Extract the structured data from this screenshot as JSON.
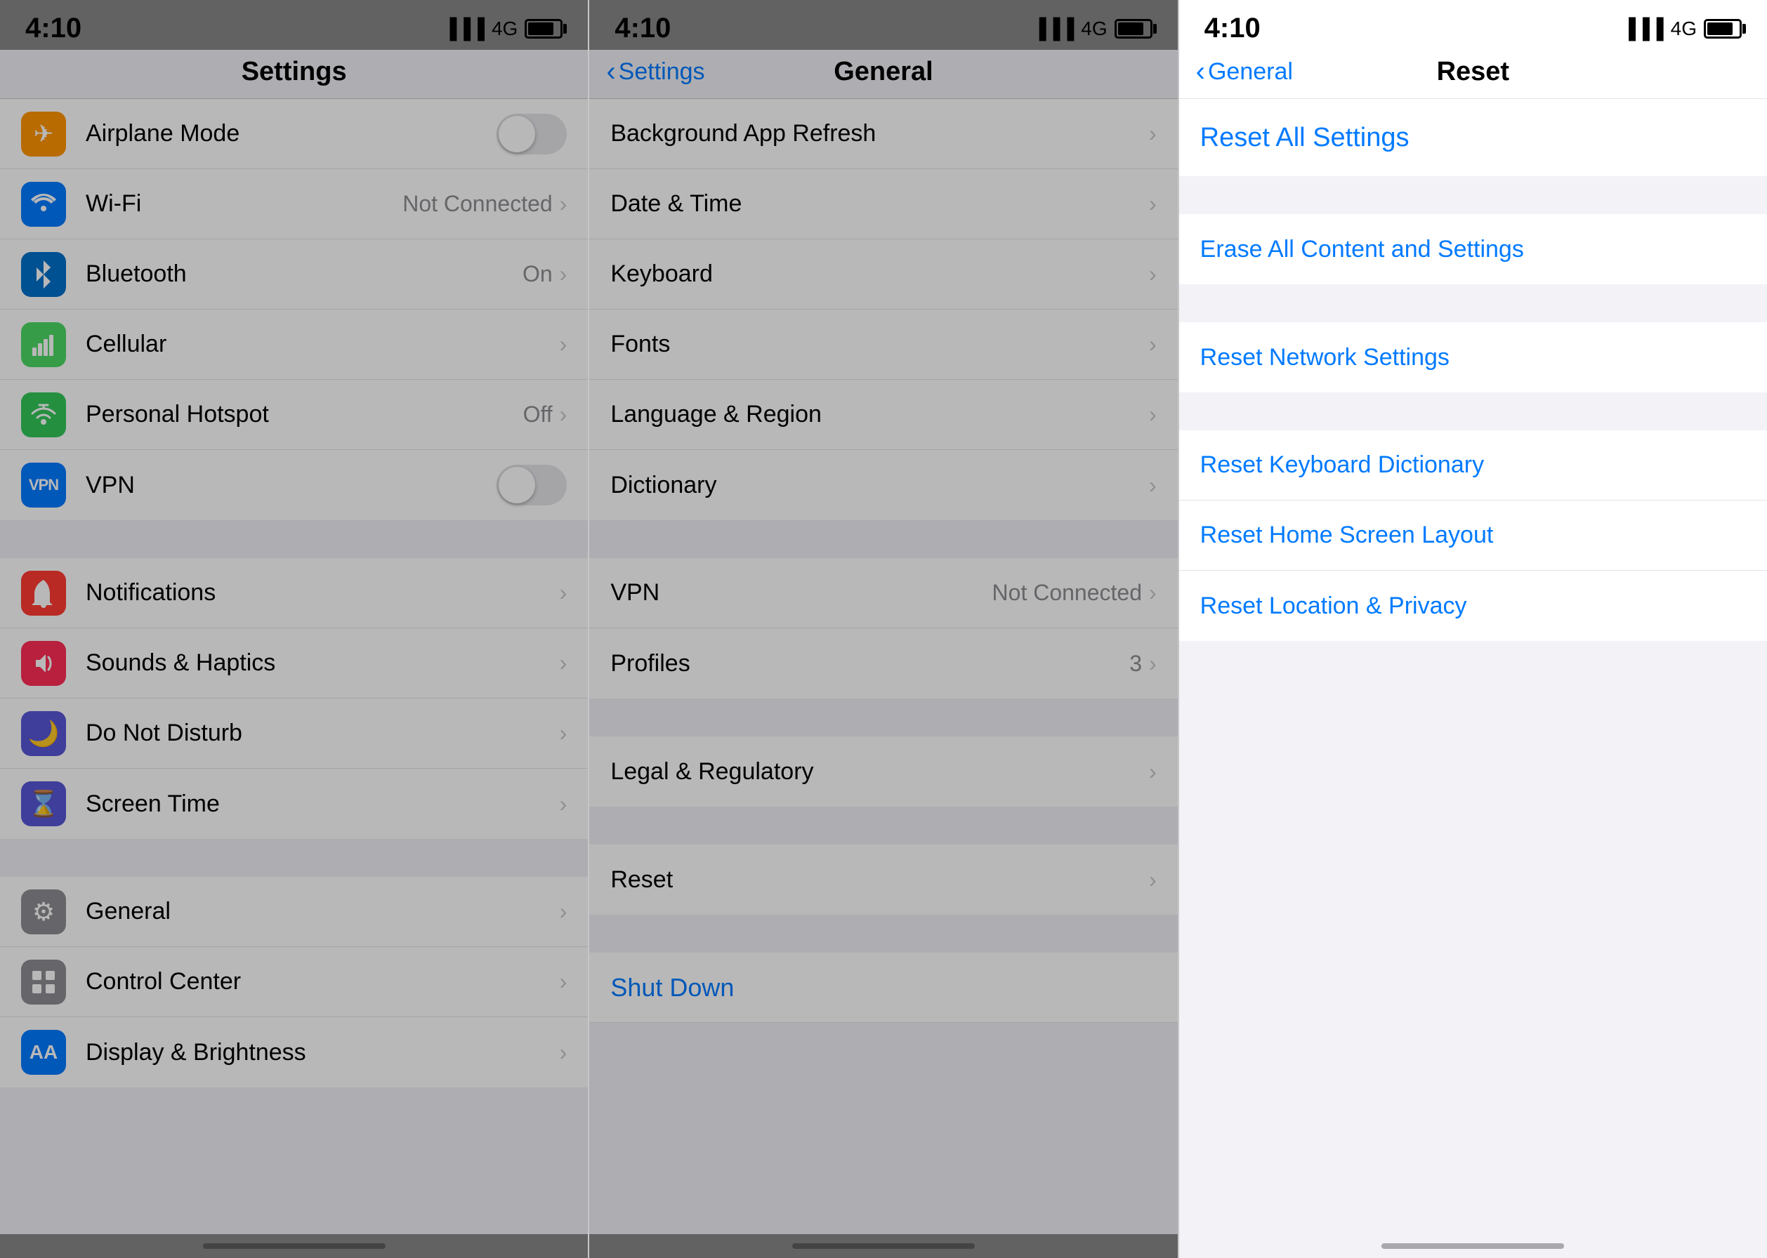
{
  "panel1": {
    "time": "4:10",
    "signal": "4G",
    "nav_title": "Settings",
    "items_group1": [
      {
        "id": "airplane",
        "label": "Airplane Mode",
        "icon_color": "orange",
        "icon_symbol": "✈",
        "type": "toggle",
        "toggle_on": false
      },
      {
        "id": "wifi",
        "label": "Wi-Fi",
        "icon_color": "blue",
        "icon_symbol": "📶",
        "type": "value",
        "value": "Not Connected"
      },
      {
        "id": "bluetooth",
        "label": "Bluetooth",
        "icon_color": "bluetooth",
        "icon_symbol": "🔷",
        "type": "value",
        "value": "On"
      },
      {
        "id": "cellular",
        "label": "Cellular",
        "icon_color": "green",
        "icon_symbol": "📡",
        "type": "chevron"
      },
      {
        "id": "hotspot",
        "label": "Personal Hotspot",
        "icon_color": "green2",
        "icon_symbol": "🔗",
        "type": "value",
        "value": "Off"
      },
      {
        "id": "vpn",
        "label": "VPN",
        "icon_color": "vpn",
        "icon_symbol": "VPN",
        "type": "toggle",
        "toggle_on": false
      }
    ],
    "items_group2": [
      {
        "id": "notifications",
        "label": "Notifications",
        "icon_color": "red",
        "icon_symbol": "🔔",
        "type": "chevron"
      },
      {
        "id": "sounds",
        "label": "Sounds & Haptics",
        "icon_color": "red2",
        "icon_symbol": "🔊",
        "type": "chevron"
      },
      {
        "id": "donotdisturb",
        "label": "Do Not Disturb",
        "icon_color": "indigo",
        "icon_symbol": "🌙",
        "type": "chevron"
      },
      {
        "id": "screentime",
        "label": "Screen Time",
        "icon_color": "screen-time",
        "icon_symbol": "⌛",
        "type": "chevron"
      }
    ],
    "items_group3": [
      {
        "id": "general",
        "label": "General",
        "icon_color": "general",
        "icon_symbol": "⚙",
        "type": "chevron",
        "highlighted": true
      },
      {
        "id": "controlcenter",
        "label": "Control Center",
        "icon_color": "control",
        "icon_symbol": "🎚",
        "type": "chevron"
      },
      {
        "id": "displaybrightness",
        "label": "Display & Brightness",
        "icon_color": "display",
        "icon_symbol": "AA",
        "type": "chevron"
      }
    ]
  },
  "panel2": {
    "time": "4:10",
    "signal": "4G",
    "nav_title": "General",
    "nav_back": "Settings",
    "items_group1": [
      {
        "id": "bgrefresh",
        "label": "Background App Refresh",
        "type": "chevron"
      },
      {
        "id": "datetime",
        "label": "Date & Time",
        "type": "chevron"
      },
      {
        "id": "keyboard",
        "label": "Keyboard",
        "type": "chevron"
      },
      {
        "id": "fonts",
        "label": "Fonts",
        "type": "chevron"
      },
      {
        "id": "language",
        "label": "Language & Region",
        "type": "chevron"
      },
      {
        "id": "dictionary",
        "label": "Dictionary",
        "type": "chevron"
      }
    ],
    "items_group2": [
      {
        "id": "vpn",
        "label": "VPN",
        "type": "value",
        "value": "Not Connected"
      },
      {
        "id": "profiles",
        "label": "Profiles",
        "type": "value",
        "value": "3"
      }
    ],
    "items_group3": [
      {
        "id": "legalreg",
        "label": "Legal & Regulatory",
        "type": "chevron"
      }
    ],
    "items_group4": [
      {
        "id": "reset",
        "label": "Reset",
        "type": "chevron"
      }
    ],
    "items_group5": [
      {
        "id": "shutdown",
        "label": "Shut Down",
        "type": "blue_action"
      }
    ]
  },
  "panel3": {
    "time": "4:10",
    "signal": "4G",
    "nav_title": "Reset",
    "nav_back": "General",
    "items_group1": [
      {
        "id": "resetallsettings",
        "label": "Reset All Settings",
        "type": "blue_top"
      }
    ],
    "items_group2": [
      {
        "id": "eraseall",
        "label": "Erase All Content and Settings",
        "type": "blue_action"
      }
    ],
    "items_group3": [
      {
        "id": "resetnetwork",
        "label": "Reset Network Settings",
        "type": "blue_action"
      }
    ],
    "items_group4": [
      {
        "id": "resetkeyboard",
        "label": "Reset Keyboard Dictionary",
        "type": "blue_action"
      },
      {
        "id": "resethomescreen",
        "label": "Reset Home Screen Layout",
        "type": "blue_action"
      },
      {
        "id": "resetlocation",
        "label": "Reset Location & Privacy",
        "type": "blue_action"
      }
    ]
  }
}
